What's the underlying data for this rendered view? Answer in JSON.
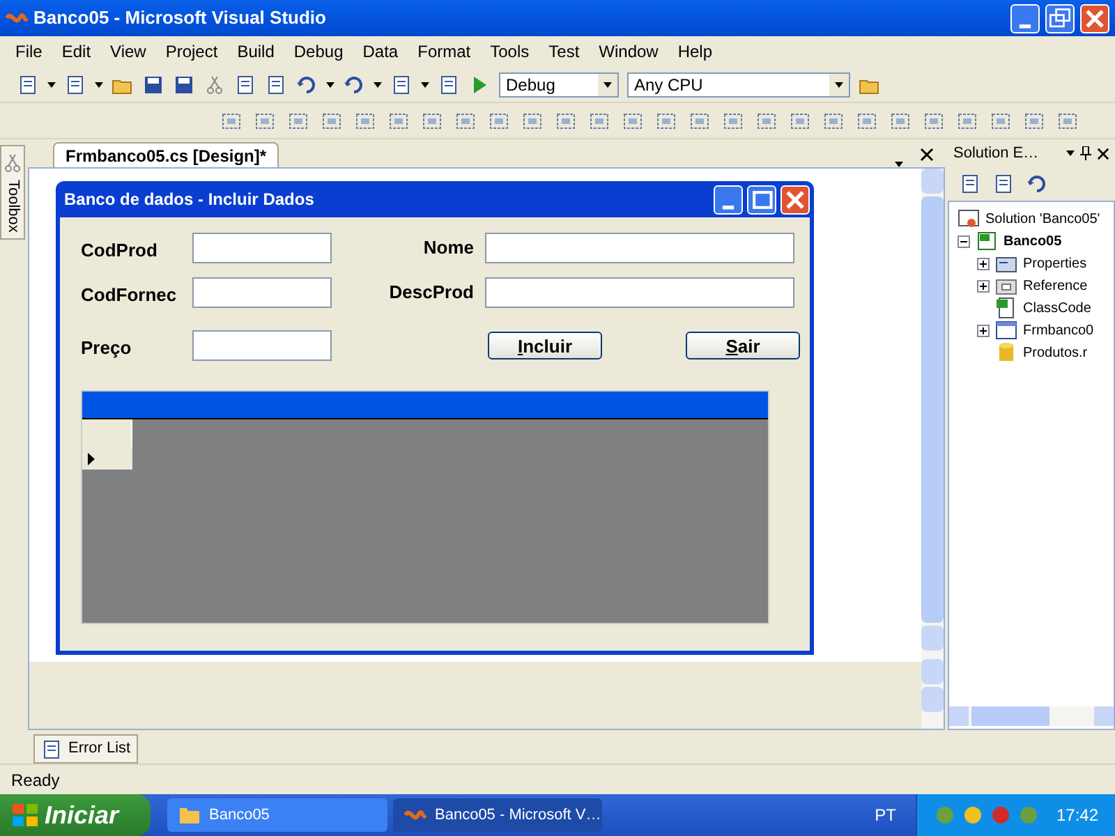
{
  "window": {
    "title": "Banco05 - Microsoft Visual Studio"
  },
  "menu": [
    "File",
    "Edit",
    "View",
    "Project",
    "Build",
    "Debug",
    "Data",
    "Format",
    "Tools",
    "Test",
    "Window",
    "Help"
  ],
  "toolbar": {
    "configuration": "Debug",
    "platform": "Any CPU"
  },
  "toolbox_tab": "Toolbox",
  "document_tabs": [
    {
      "label": "Frmbanco05.cs [Design]*",
      "selected": true
    }
  ],
  "form": {
    "title": "Banco de dados - Incluir Dados",
    "rows": [
      {
        "fields": [
          {
            "label": "CodProd"
          },
          {
            "label": "Nome"
          }
        ]
      },
      {
        "fields": [
          {
            "label": "CodFornec"
          },
          {
            "label": "DescProd"
          }
        ]
      },
      {
        "fields": [
          {
            "label": "Preço"
          }
        ],
        "buttons": [
          "Incluir",
          "Sair"
        ]
      }
    ]
  },
  "solution_explorer": {
    "title": "Solution E…",
    "tree": [
      {
        "label": "Solution 'Banco05'",
        "kind": "solution",
        "children": [
          {
            "label": "Banco05",
            "kind": "project",
            "expanded": true,
            "children": [
              {
                "label": "Properties",
                "kind": "properties",
                "expanded": false
              },
              {
                "label": "Reference",
                "kind": "references",
                "expanded": false
              },
              {
                "label": "ClassCode",
                "kind": "csfile"
              },
              {
                "label": "Frmbanco0",
                "kind": "form",
                "expanded": false
              },
              {
                "label": "Produtos.r",
                "kind": "database"
              }
            ]
          }
        ]
      }
    ]
  },
  "bottom_tabs": [
    "Error List"
  ],
  "status_bar": "Ready",
  "taskbar": {
    "start": "Iniciar",
    "tasks": [
      {
        "label": "Banco05",
        "kind": "folder",
        "selected": false
      },
      {
        "label": "Banco05 - Microsoft V…",
        "kind": "vs",
        "selected": true
      }
    ],
    "language": "PT",
    "clock": "17:42"
  }
}
